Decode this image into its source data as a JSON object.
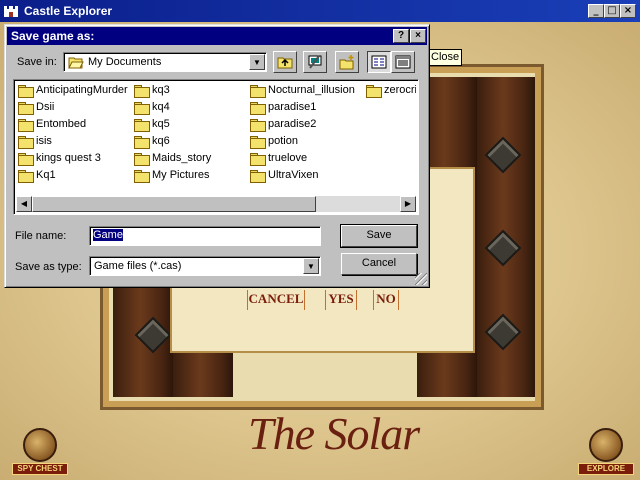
{
  "app": {
    "title": "Castle Explorer",
    "controls": {
      "minimize": "_",
      "maximize": "□",
      "close": "×"
    }
  },
  "game": {
    "tooltip": "Close",
    "buttons": {
      "cancel": "CANCEL",
      "yes": "YES",
      "no": "NO"
    },
    "logo_text": "The Solar",
    "spy_chest_label": "SPY CHEST",
    "explore_label": "EXPLORE"
  },
  "dialog": {
    "title": "Save game as:",
    "help": "?",
    "close": "×",
    "save_in_label": "Save in:",
    "save_in_value": "My Documents",
    "files": [
      "AnticipatingMurder",
      "Dsii",
      "Entombed",
      "isis",
      "kings quest 3",
      "Kq1",
      "kq3",
      "kq4",
      "kq5",
      "kq6",
      "Maids_story",
      "My Pictures",
      "Nocturnal_illusion",
      "paradise1",
      "paradise2",
      "potion",
      "truelove",
      "UltraVixen",
      "zerocrit"
    ],
    "file_name_label": "File name:",
    "file_name_value": "Game",
    "save_as_type_label": "Save as type:",
    "save_as_type_value": "Game files (*.cas)",
    "save_button": "Save",
    "cancel_button": "Cancel"
  }
}
